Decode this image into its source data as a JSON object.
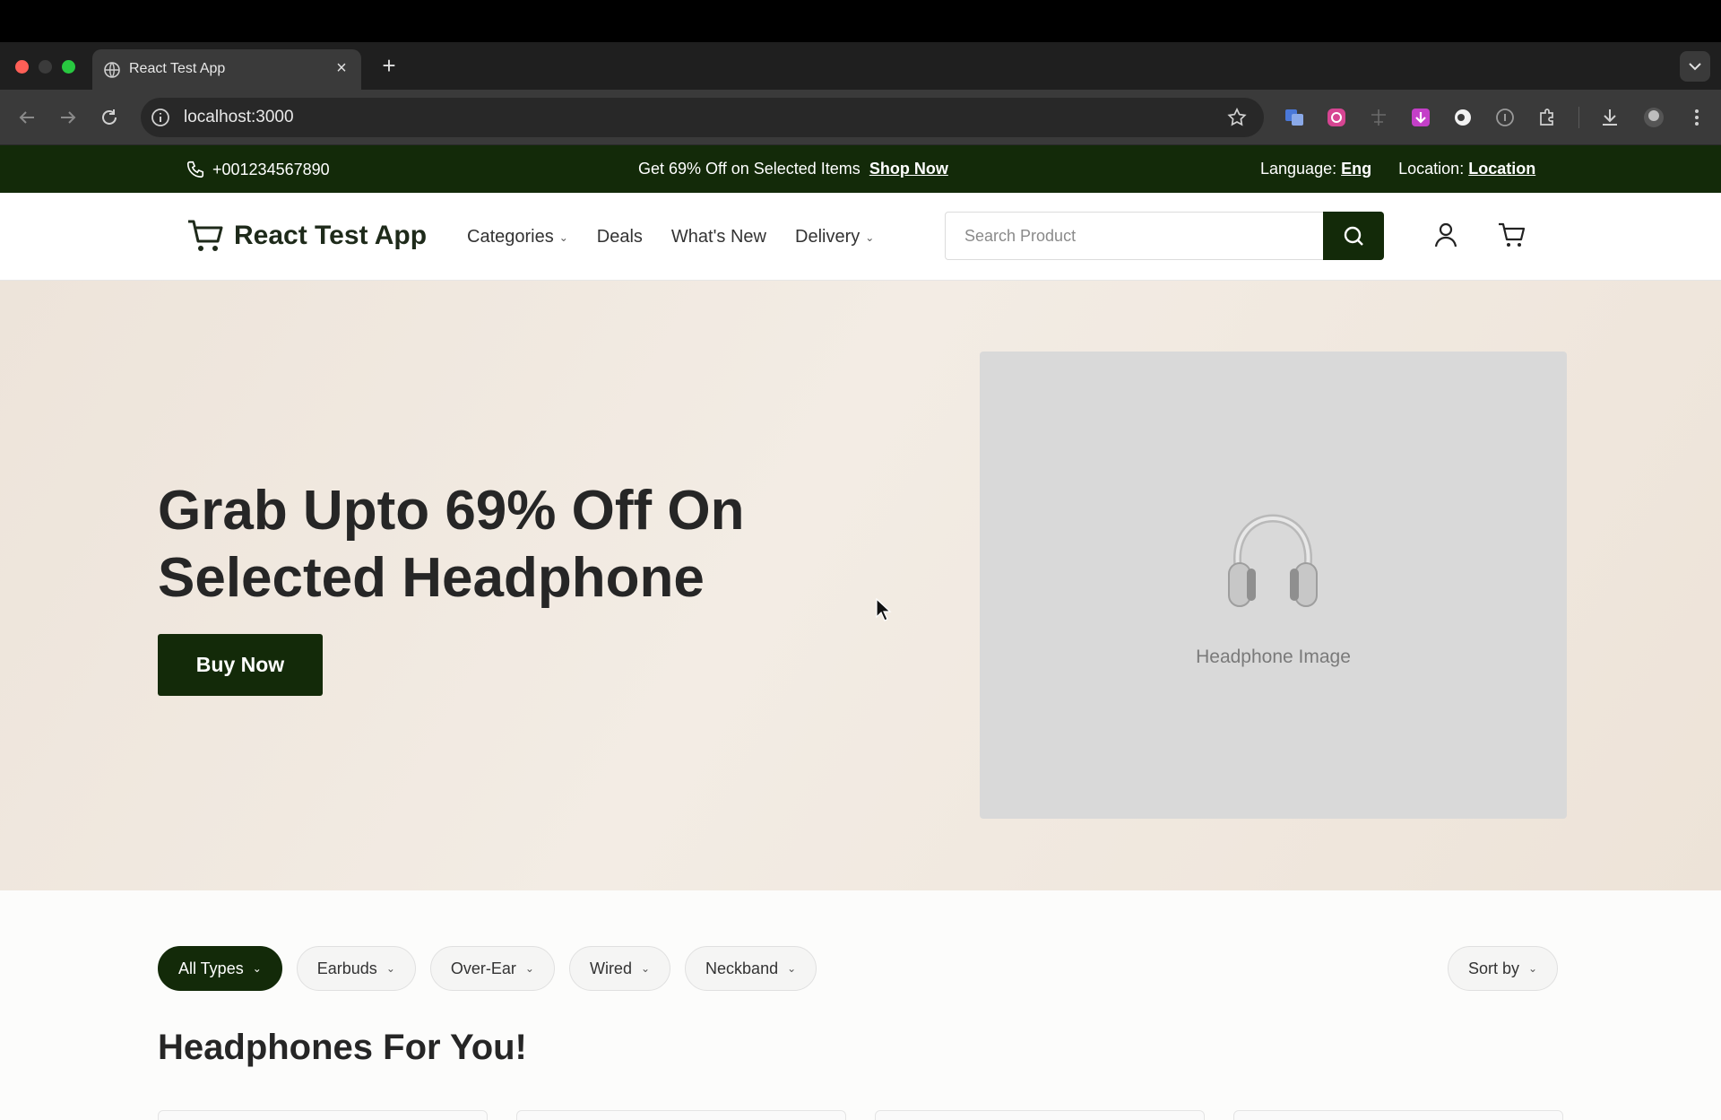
{
  "browser": {
    "tab_title": "React Test App",
    "url": "localhost:3000"
  },
  "announcement": {
    "phone": "+001234567890",
    "promo_text": "Get 69% Off on Selected Items",
    "promo_link": "Shop Now",
    "language_label": "Language:",
    "language_value": "Eng",
    "location_label": "Location:",
    "location_value": "Location"
  },
  "header": {
    "logo_text": "React Test App",
    "nav": {
      "categories": "Categories",
      "deals": "Deals",
      "whats_new": "What's New",
      "delivery": "Delivery"
    },
    "search_placeholder": "Search Product"
  },
  "hero": {
    "title_line1": "Grab Upto 69% Off On",
    "title_line2": "Selected Headphone",
    "cta": "Buy Now",
    "image_caption": "Headphone Image"
  },
  "filters": {
    "all_types": "All Types",
    "earbuds": "Earbuds",
    "over_ear": "Over-Ear",
    "wired": "Wired",
    "neckband": "Neckband",
    "sort_by": "Sort by"
  },
  "section_title": "Headphones For You!",
  "colors": {
    "brand_dark": "#132a09",
    "hero_bg": "#ede4da"
  }
}
